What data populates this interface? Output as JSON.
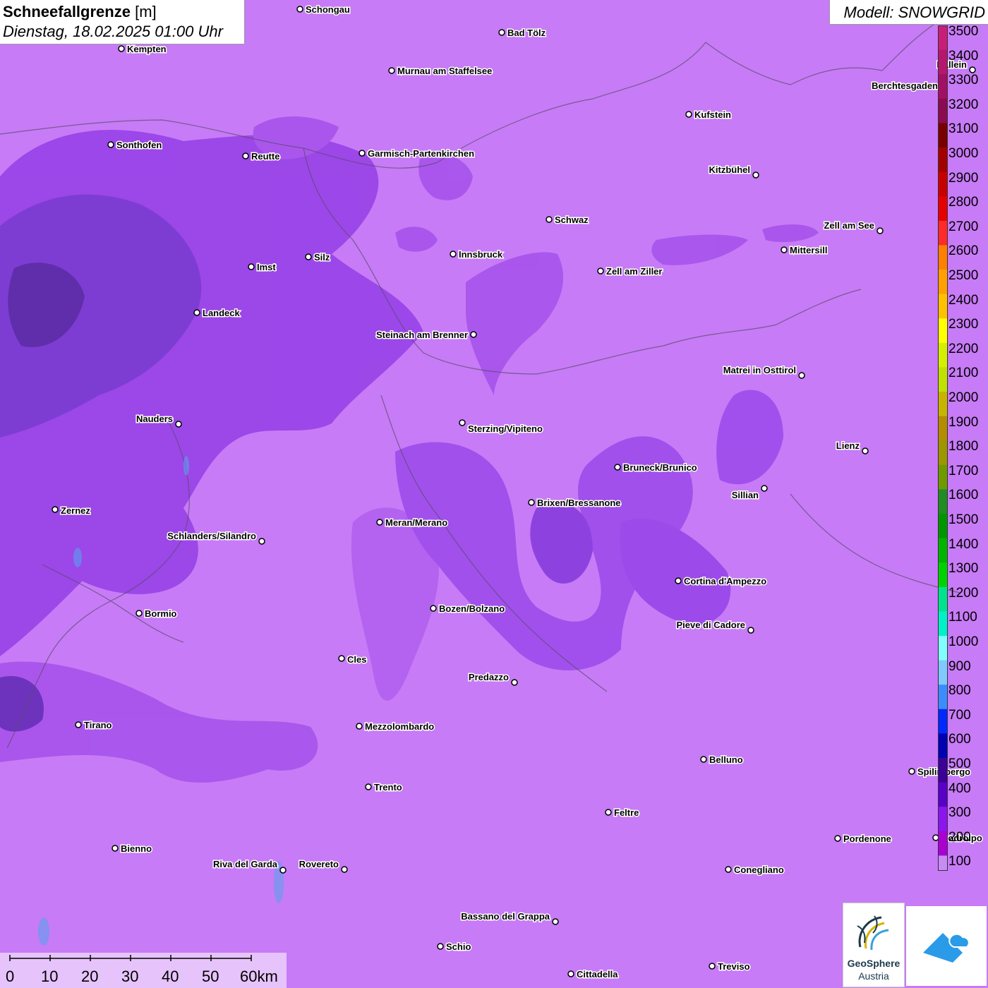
{
  "title": {
    "main": "Schneefallgrenze",
    "unit": "[m]",
    "subtitle": "Dienstag, 18.02.2025 01:00 Uhr"
  },
  "model": "Modell: SNOWGRID",
  "legend": {
    "labels": [
      "3500",
      "3400",
      "3300",
      "3200",
      "3100",
      "3000",
      "2900",
      "2800",
      "2700",
      "2600",
      "2500",
      "2400",
      "2300",
      "2200",
      "2100",
      "2000",
      "1900",
      "1800",
      "1700",
      "1600",
      "1500",
      "1400",
      "1300",
      "1200",
      "1100",
      "1000",
      "900",
      "800",
      "700",
      "600",
      "500",
      "400",
      "300",
      "200",
      "100"
    ],
    "colors": [
      "#c81e7a",
      "#b5176e",
      "#a11064",
      "#8a0b50",
      "#780000",
      "#a50000",
      "#c80000",
      "#e60000",
      "#ff2a2a",
      "#ff7f00",
      "#ffa000",
      "#ffc000",
      "#ffff00",
      "#d4f000",
      "#c0e000",
      "#c8b400",
      "#b48c00",
      "#9c9600",
      "#6e9a00",
      "#228b22",
      "#009600",
      "#00b400",
      "#00d200",
      "#00e28c",
      "#00f0c8",
      "#80ffff",
      "#80c8ff",
      "#3c8cff",
      "#0028ff",
      "#0000b4",
      "#3c0096",
      "#5a00c8",
      "#8c14f0",
      "#aa00d2",
      "#c78cf6"
    ]
  },
  "cities": [
    {
      "name": "Schongau"
    },
    {
      "name": "Bad Tölz"
    },
    {
      "name": "Kempten"
    },
    {
      "name": "Murnau am Staffelsee"
    },
    {
      "name": "Berchtesgaden"
    },
    {
      "name": "Kufstein"
    },
    {
      "name": "Sonthofen"
    },
    {
      "name": "Reutte"
    },
    {
      "name": "Garmisch-Partenkirchen"
    },
    {
      "name": "Kitzbühel"
    },
    {
      "name": "Schwaz"
    },
    {
      "name": "Zell am See"
    },
    {
      "name": "Innsbruck"
    },
    {
      "name": "Mittersill"
    },
    {
      "name": "Imst"
    },
    {
      "name": "Silz"
    },
    {
      "name": "Zell am Ziller"
    },
    {
      "name": "Landeck"
    },
    {
      "name": "Steinach am Brenner"
    },
    {
      "name": "Matrei in Osttirol"
    },
    {
      "name": "Nauders"
    },
    {
      "name": "Sterzing/Vipiteno"
    },
    {
      "name": "Lienz"
    },
    {
      "name": "Bruneck/Brunico"
    },
    {
      "name": "Sillian"
    },
    {
      "name": "Zernez"
    },
    {
      "name": "Brixen/Bressanone"
    },
    {
      "name": "Meran/Merano"
    },
    {
      "name": "Schlanders/Silandro"
    },
    {
      "name": "Cortina d'Ampezzo"
    },
    {
      "name": "Bozen/Bolzano"
    },
    {
      "name": "Bormio"
    },
    {
      "name": "Pieve di Cadore"
    },
    {
      "name": "Cles"
    },
    {
      "name": "Predazzo"
    },
    {
      "name": "Tirano"
    },
    {
      "name": "Mezzolombardo"
    },
    {
      "name": "Belluno"
    },
    {
      "name": "Spilimbergo"
    },
    {
      "name": "Trento"
    },
    {
      "name": "Feltre"
    },
    {
      "name": "Pordenone"
    },
    {
      "name": "Bienno"
    },
    {
      "name": "Riva del Garda"
    },
    {
      "name": "Rovereto"
    },
    {
      "name": "Conegliano"
    },
    {
      "name": "Bassano del Grappa"
    },
    {
      "name": "Schio"
    },
    {
      "name": "Treviso"
    },
    {
      "name": "Cittadella"
    },
    {
      "name": "Hallein"
    },
    {
      "name": "Codroipo"
    }
  ],
  "scale": {
    "labels": [
      "0",
      "10",
      "20",
      "30",
      "40",
      "50",
      "60km"
    ]
  },
  "logos": {
    "geosphere_line1": "GeoSphere",
    "geosphere_line2": "Austria"
  }
}
